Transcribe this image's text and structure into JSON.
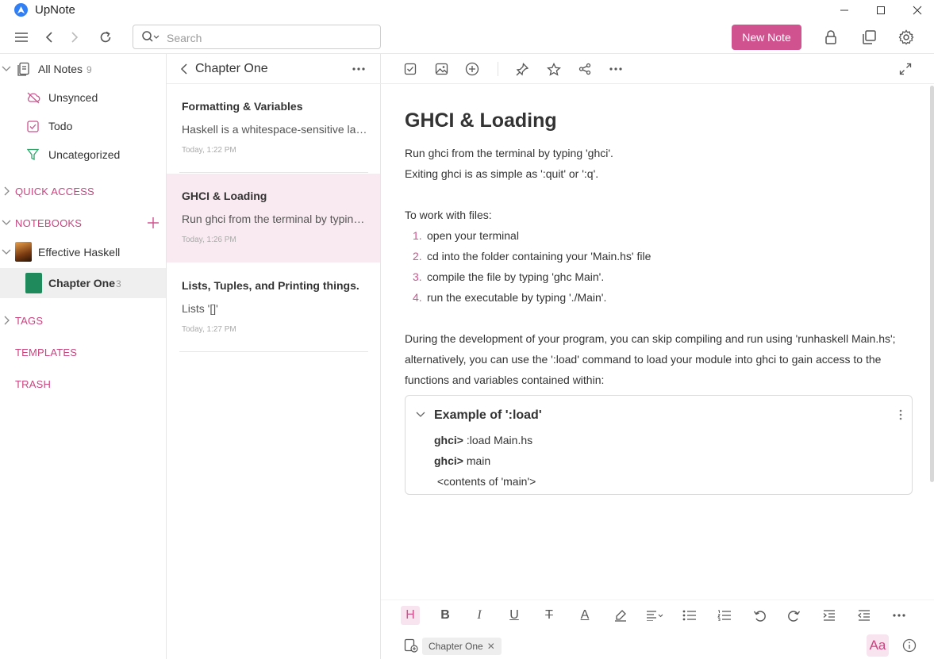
{
  "app": {
    "title": "UpNote"
  },
  "search": {
    "placeholder": "Search"
  },
  "header": {
    "new_note_label": "New Note"
  },
  "sidebar": {
    "all_notes": {
      "label": "All Notes",
      "count": "9"
    },
    "items": [
      {
        "label": "Unsynced",
        "icon": "cloud-off-icon"
      },
      {
        "label": "Todo",
        "icon": "checkbox-icon"
      },
      {
        "label": "Uncategorized",
        "icon": "filter-icon"
      }
    ],
    "quick_access": "QUICK ACCESS",
    "notebooks": "NOTEBOOKS",
    "notebook": {
      "label": "Effective Haskell"
    },
    "sub_notebook": {
      "label": "Chapter One",
      "count": "3"
    },
    "tags": "TAGS",
    "templates": "TEMPLATES",
    "trash": "TRASH"
  },
  "notelist": {
    "title": "Chapter One",
    "notes": [
      {
        "title": "Formatting & Variables",
        "snippet": "Haskell is a whitespace-sensitive language...",
        "time": "Today, 1:22 PM"
      },
      {
        "title": "GHCI & Loading",
        "snippet": "Run ghci from the terminal by typing 'ghci'.",
        "time": "Today, 1:26 PM"
      },
      {
        "title": "Lists, Tuples, and Printing things.",
        "snippet": "Lists '[]'",
        "time": "Today, 1:27 PM"
      }
    ]
  },
  "editor": {
    "title": "GHCI & Loading",
    "p1": "Run ghci from the terminal by typing 'ghci'.",
    "p2": "Exiting ghci is as simple as ':quit' or ':q'.",
    "p3": "To work with files:",
    "list": [
      {
        "num": "1.",
        "text": "open your terminal"
      },
      {
        "num": "2.",
        "text": "cd into the folder containing your 'Main.hs' file"
      },
      {
        "num": "3.",
        "text": "compile the file by typing 'ghc Main'."
      },
      {
        "num": "4.",
        "text": "run the executable by typing './Main'."
      }
    ],
    "p4": "During the development of your program, you can skip compiling and run using 'runhaskell Main.hs';",
    "p5": "alternatively, you can use the ':load' command to load your module into ghci to gain access to the",
    "p6": "functions and variables contained within:",
    "toggle": {
      "title": "Example of ':load'",
      "lines": [
        {
          "prompt": "ghci>",
          "cmd": " :load Main.hs"
        },
        {
          "prompt": "ghci>",
          "cmd": " main"
        },
        {
          "prompt": "",
          "cmd": " <contents of 'main'>"
        }
      ]
    },
    "format_heading": "H",
    "format_bold": "B",
    "format_italic": "I",
    "format_underline": "U",
    "format_strike": "T",
    "format_color": "A",
    "tag": "Chapter One",
    "font_btn": "Aa"
  },
  "colors": {
    "accent": "#d0528f",
    "section": "#c8457f",
    "selected_note": "#f9e9f0"
  }
}
